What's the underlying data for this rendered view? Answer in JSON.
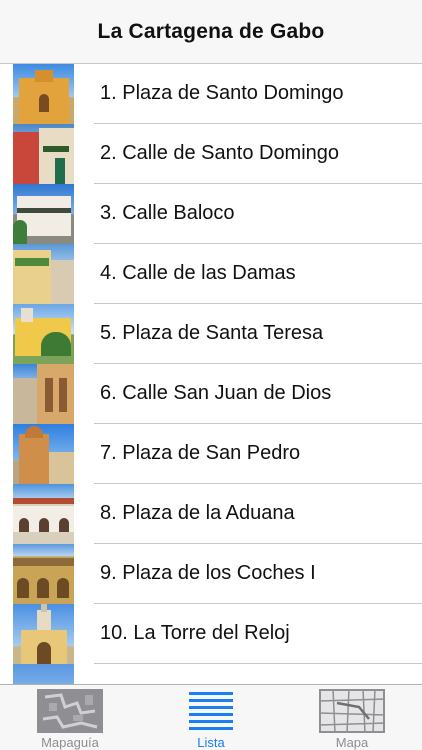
{
  "navbar": {
    "title": "La Cartagena de Gabo"
  },
  "list": {
    "items": [
      {
        "label": "1. Plaza de Santo Domingo"
      },
      {
        "label": "2. Calle de Santo Domingo"
      },
      {
        "label": "3. Calle Baloco"
      },
      {
        "label": "4. Calle de las Damas"
      },
      {
        "label": "5. Plaza de Santa Teresa"
      },
      {
        "label": "6. Calle San Juan de Dios"
      },
      {
        "label": "7. Plaza de San Pedro"
      },
      {
        "label": "8. Plaza de la Aduana"
      },
      {
        "label": "9. Plaza de los Coches I"
      },
      {
        "label": "10. La Torre del Reloj"
      }
    ]
  },
  "tabbar": {
    "tabs": [
      {
        "label": "Mapaguía",
        "icon": "guide-map-icon"
      },
      {
        "label": "Lista",
        "icon": "list-icon",
        "selected": true
      },
      {
        "label": "Mapa",
        "icon": "map-icon"
      }
    ]
  },
  "colors": {
    "accent": "#1a7ef5",
    "tab_inactive": "#8e8e93",
    "separator": "#c8c7cc",
    "bar_background": "#f7f7f8"
  }
}
